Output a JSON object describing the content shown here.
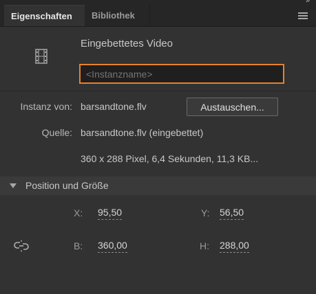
{
  "tabs": [
    {
      "label": "Eigenschaften",
      "active": true
    },
    {
      "label": "Bibliothek",
      "active": false
    }
  ],
  "header_arrows": "»",
  "object": {
    "type_label": "Eingebettetes Video",
    "icon": "film-icon",
    "instance_name_placeholder": "<Instanzname>",
    "instance_name_value": ""
  },
  "info": {
    "instance_of_label": "Instanz von:",
    "instance_of_value": "barsandtone.flv",
    "swap_button": "Austauschen...",
    "source_label": "Quelle:",
    "source_value": "barsandtone.flv (eingebettet)",
    "details": "360 x 288 Pixel, 6,4 Sekunden, 11,3 KB..."
  },
  "position_size": {
    "title": "Position und Größe",
    "x_label": "X:",
    "x_value": "95,50",
    "y_label": "Y:",
    "y_value": "56,50",
    "w_label": "B:",
    "w_value": "360,00",
    "h_label": "H:",
    "h_value": "288,00",
    "lock_icon": "link-icon"
  },
  "colors": {
    "panel_bg": "#323232",
    "focus_border": "#e8822e"
  }
}
